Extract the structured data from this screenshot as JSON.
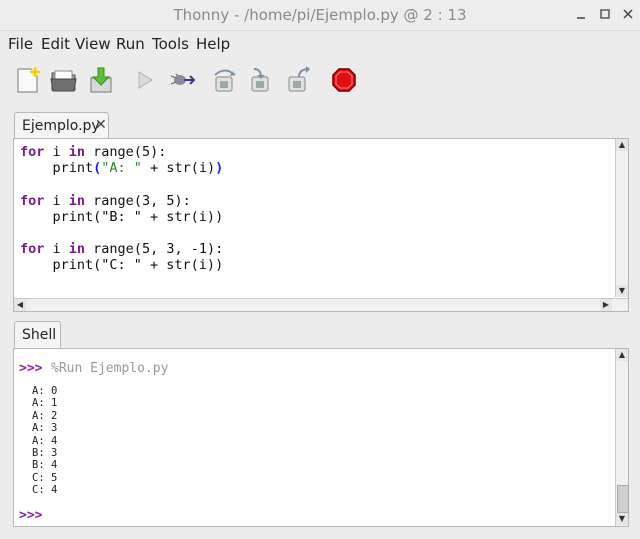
{
  "window": {
    "title": "Thonny  -  /home/pi/Ejemplo.py  @  2 : 13"
  },
  "menu": [
    "File",
    "Edit",
    "View",
    "Run",
    "Tools",
    "Help"
  ],
  "toolbar": [
    {
      "name": "new-file-icon"
    },
    {
      "name": "open-file-icon"
    },
    {
      "name": "save-file-icon"
    },
    {
      "name": "run-icon"
    },
    {
      "name": "debug-icon"
    },
    {
      "name": "step-over-icon"
    },
    {
      "name": "step-into-icon"
    },
    {
      "name": "step-out-icon"
    },
    {
      "name": "stop-icon"
    }
  ],
  "editor": {
    "tab_label": "Ejemplo.py",
    "tab_close": "✕",
    "lines": [
      [
        {
          "t": "for",
          "c": "kw"
        },
        {
          "t": " i "
        },
        {
          "t": "in",
          "c": "kw"
        },
        {
          "t": " range(5):"
        }
      ],
      [
        {
          "t": "    print"
        },
        {
          "t": "(",
          "c": "par"
        },
        {
          "t": "\"A: \"",
          "c": "str"
        },
        {
          "t": " + str(i)"
        },
        {
          "t": ")",
          "c": "par"
        }
      ],
      [],
      [
        {
          "t": "for",
          "c": "kw"
        },
        {
          "t": " i "
        },
        {
          "t": "in",
          "c": "kw"
        },
        {
          "t": " range(3, 5):"
        }
      ],
      [
        {
          "t": "    print(\"B: \" + str(i))"
        }
      ],
      [],
      [
        {
          "t": "for",
          "c": "kw"
        },
        {
          "t": " i "
        },
        {
          "t": "in",
          "c": "kw"
        },
        {
          "t": " range(5, 3, -1):"
        }
      ],
      [
        {
          "t": "    print(\"C: \" + str(i))"
        }
      ]
    ]
  },
  "shell": {
    "tab_label": "Shell",
    "prompt": ">>>",
    "run_command": "%Run Ejemplo.py",
    "output": [
      "A: 0",
      "A: 1",
      "A: 2",
      "A: 3",
      "A: 4",
      "B: 3",
      "B: 4",
      "C: 5",
      "C: 4"
    ],
    "final_prompt": ">>>"
  },
  "colors": {
    "keyword": "#7b1b8c",
    "prompt": "#8b1fa8",
    "stop": "#e01010"
  }
}
